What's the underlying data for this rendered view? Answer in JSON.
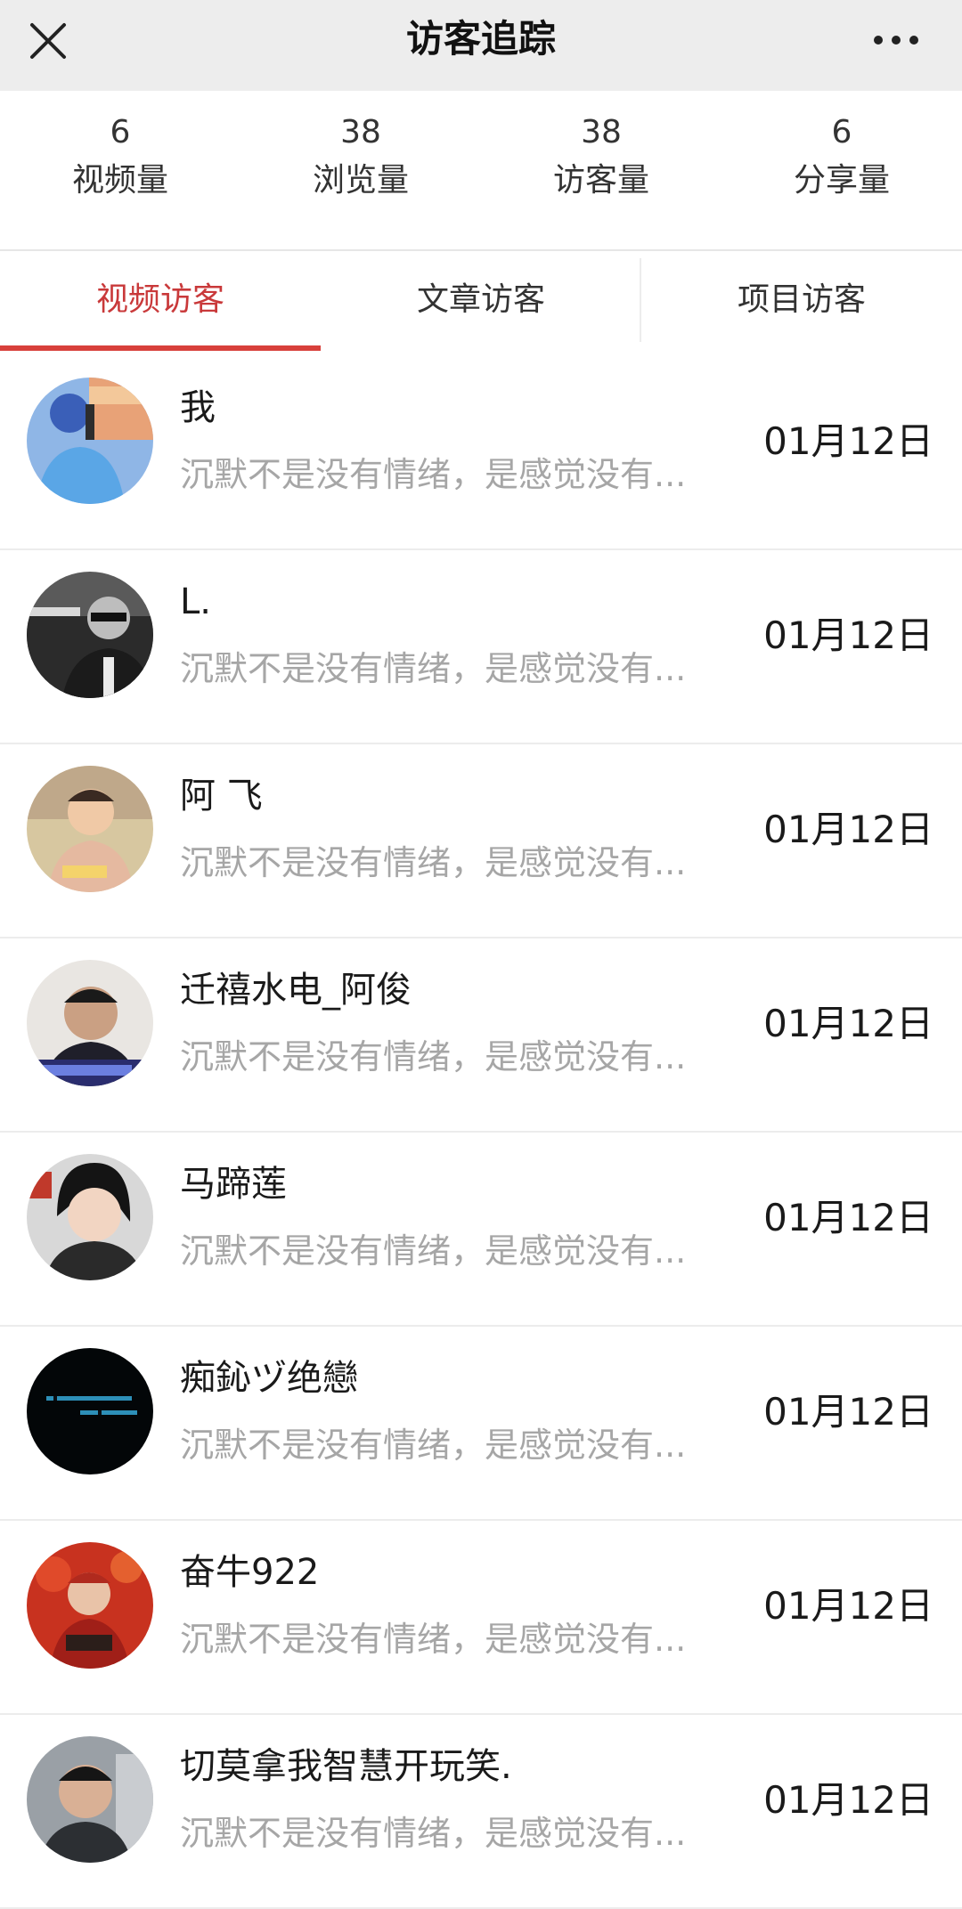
{
  "header": {
    "title": "访客追踪"
  },
  "stats": [
    {
      "value": "6",
      "label": "视频量"
    },
    {
      "value": "38",
      "label": "浏览量"
    },
    {
      "value": "38",
      "label": "访客量"
    },
    {
      "value": "6",
      "label": "分享量"
    }
  ],
  "tabs": [
    {
      "label": "视频访客",
      "active": true
    },
    {
      "label": "文章访客",
      "active": false
    },
    {
      "label": "项目访客",
      "active": false
    }
  ],
  "colors": {
    "accent": "#d8403b",
    "topbar_bg": "#ededed",
    "muted_text": "#a6a6a6"
  },
  "visitors": [
    {
      "name": "我",
      "desc": "沉默不是没有情绪，是感觉没有...",
      "date": "01月12日",
      "avatar_icon": "person-photo-icon"
    },
    {
      "name": "L.",
      "desc": "沉默不是没有情绪，是感觉没有...",
      "date": "01月12日",
      "avatar_icon": "person-photo-icon"
    },
    {
      "name": "阿 飞",
      "desc": "沉默不是没有情绪，是感觉没有...",
      "date": "01月12日",
      "avatar_icon": "child-photo-icon"
    },
    {
      "name": "迁禧水电_阿俊",
      "desc": "沉默不是没有情绪，是感觉没有...",
      "date": "01月12日",
      "avatar_icon": "person-photo-icon"
    },
    {
      "name": "马蹄莲",
      "desc": "沉默不是没有情绪，是感觉没有...",
      "date": "01月12日",
      "avatar_icon": "child-photo-icon"
    },
    {
      "name": "痴鈊ヅ绝戀",
      "desc": "沉默不是没有情绪，是感觉没有...",
      "date": "01月12日",
      "avatar_icon": "dark-text-photo-icon"
    },
    {
      "name": "奋牛922",
      "desc": "沉默不是没有情绪，是感觉没有...",
      "date": "01月12日",
      "avatar_icon": "child-photo-icon"
    },
    {
      "name": "切莫拿我智慧开玩笑.",
      "desc": "沉默不是没有情绪，是感觉没有...",
      "date": "01月12日",
      "avatar_icon": "person-photo-icon"
    }
  ]
}
